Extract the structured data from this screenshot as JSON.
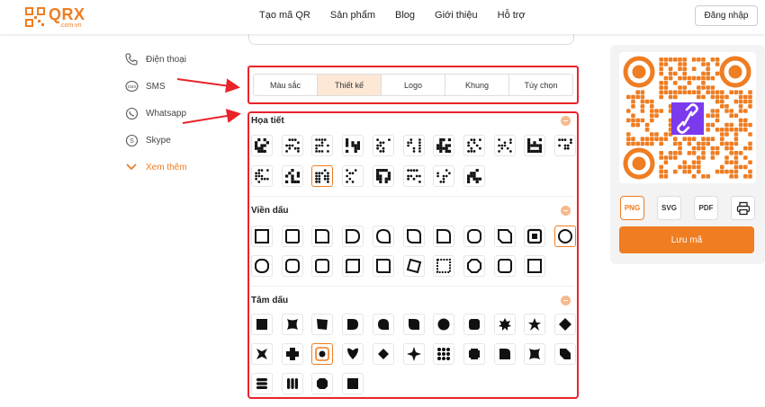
{
  "brand": {
    "name": "QRX",
    "domain": ".com.vn",
    "accent": "#ef7d22"
  },
  "header": {
    "nav": [
      "Tạo mã QR",
      "Sản phẩm",
      "Blog",
      "Giới thiệu",
      "Hỗ trợ"
    ],
    "login_label": "Đăng nhập"
  },
  "sidebar": {
    "items": [
      {
        "label": "Điện thoại",
        "icon": "phone-icon"
      },
      {
        "label": "SMS",
        "icon": "sms-icon"
      },
      {
        "label": "Whatsapp",
        "icon": "whatsapp-icon"
      },
      {
        "label": "Skype",
        "icon": "skype-icon"
      }
    ],
    "more_label": "Xem thêm"
  },
  "tabs": {
    "items": [
      "Màu sắc",
      "Thiết kế",
      "Logo",
      "Khung",
      "Tùy chọn"
    ],
    "active": "Thiết kế"
  },
  "sections": {
    "pattern_title": "Họa tiết",
    "eye_frame_title": "Viền dấu",
    "eye_ball_title": "Tâm dấu"
  },
  "export": {
    "formats": [
      "PNG",
      "SVG",
      "PDF"
    ],
    "selected_format": "PNG",
    "print_icon": "printer-icon",
    "save_label": "Lưu mã"
  },
  "qr": {
    "center_icon": "link-icon",
    "center_color": "#7c3aed"
  }
}
